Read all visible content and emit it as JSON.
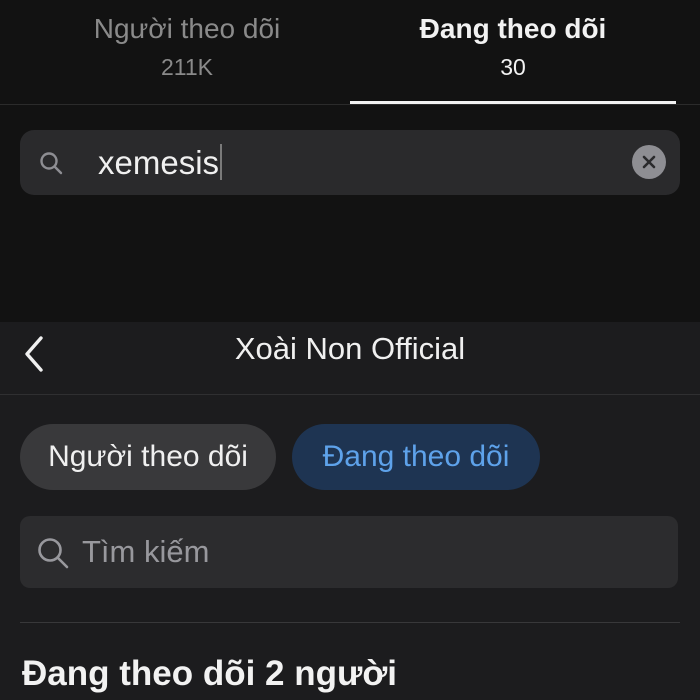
{
  "profile_tabs": {
    "followers": {
      "label": "Người theo dõi",
      "count": "211K"
    },
    "following": {
      "label": "Đang theo dõi",
      "count": "30"
    },
    "active_tab": "following"
  },
  "top_search": {
    "value": "xemesis"
  },
  "following_screen": {
    "title": "Xoài Non Official",
    "tabs": {
      "followers_label": "Người theo dõi",
      "following_label": "Đang theo dõi",
      "active": "following"
    },
    "search_placeholder": "Tìm kiếm",
    "section_heading": "Đang theo dõi 2 người"
  },
  "colors": {
    "active_pill_bg": "#1e3452",
    "active_pill_text": "#5ea2ea",
    "top_background": "#121212",
    "bottom_background": "#1c1c1e"
  },
  "icons": {
    "top_search": "search-icon",
    "clear": "clear-icon",
    "back": "chevron-left-icon",
    "bottom_search": "search-icon"
  }
}
